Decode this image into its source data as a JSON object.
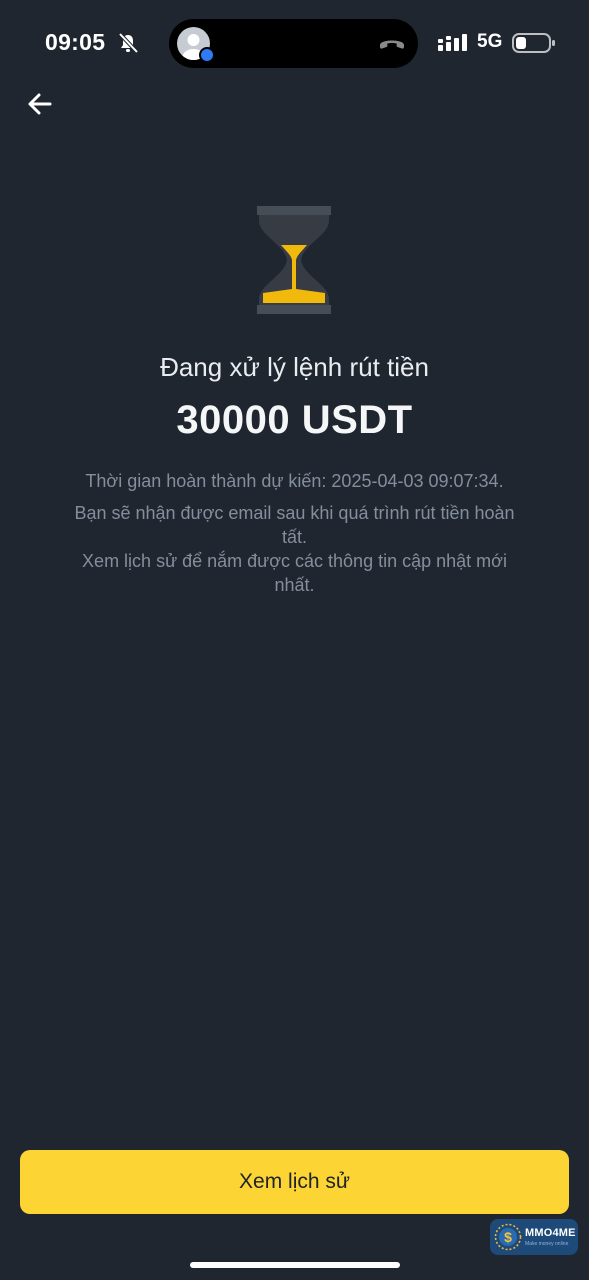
{
  "status_bar": {
    "time": "09:05",
    "network": "5G",
    "icons": [
      "bell-muted-icon",
      "signal-icon",
      "battery-icon"
    ]
  },
  "island": {
    "icons": [
      "avatar-icon",
      "phone-hangup-icon"
    ]
  },
  "header": {
    "back_icon": "back-arrow-icon"
  },
  "main": {
    "status_icon": "hourglass-icon",
    "title": "Đang xử lý lệnh rút tiền",
    "amount": "30000 USDT",
    "eta_text": "Thời gian hoàn thành dự kiến: 2025-04-03 09:07:34.",
    "email_text": "Bạn sẽ nhận được email sau khi quá trình rút tiền hoàn tất.",
    "history_text": "Xem lịch sử để nắm được các thông tin cập nhật mới nhất."
  },
  "footer": {
    "button_label": "Xem lịch sử"
  },
  "watermark": {
    "logo_text": "MMO4ME",
    "tagline": "Make money online"
  },
  "colors": {
    "background": "#1f2630",
    "accent": "#fcd535",
    "secondary_text": "#848e9c"
  }
}
